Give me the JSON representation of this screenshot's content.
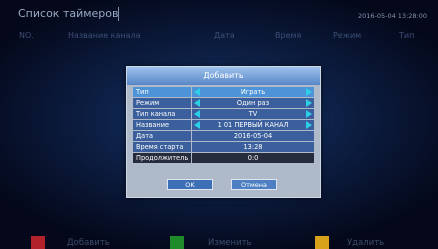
{
  "header": {
    "title": "Список таймеров",
    "clock": "2016-05-04 13:28:00"
  },
  "table": {
    "columns": [
      "NO.",
      "Название канала",
      "Дата",
      "Время",
      "Режим",
      "Тип"
    ]
  },
  "dialog": {
    "title": "Добавить",
    "rows": [
      {
        "label": "Тип",
        "value": "Играть"
      },
      {
        "label": "Режим",
        "value": "Один раз"
      },
      {
        "label": "Тип канала",
        "value": "TV"
      },
      {
        "label": "Название",
        "value": "1  01 ПЕРВЫЙ КАНАЛ"
      },
      {
        "label": "Дата",
        "value": "2016-05-04"
      },
      {
        "label": "Время старта",
        "value": "13:28"
      },
      {
        "label": "Продолжитель",
        "value": "0:0"
      }
    ],
    "ok_label": "OK",
    "cancel_label": "Отмена"
  },
  "legend": {
    "add_label": "Добавить",
    "edit_label": "Изменить",
    "delete_label": "Удалить"
  },
  "colors": {
    "red_key": "#b2222a",
    "green_key": "#1f8a2a",
    "yellow_key": "#d9a21b",
    "accent": "#4e93d8",
    "arrow": "#2ccfe8"
  }
}
